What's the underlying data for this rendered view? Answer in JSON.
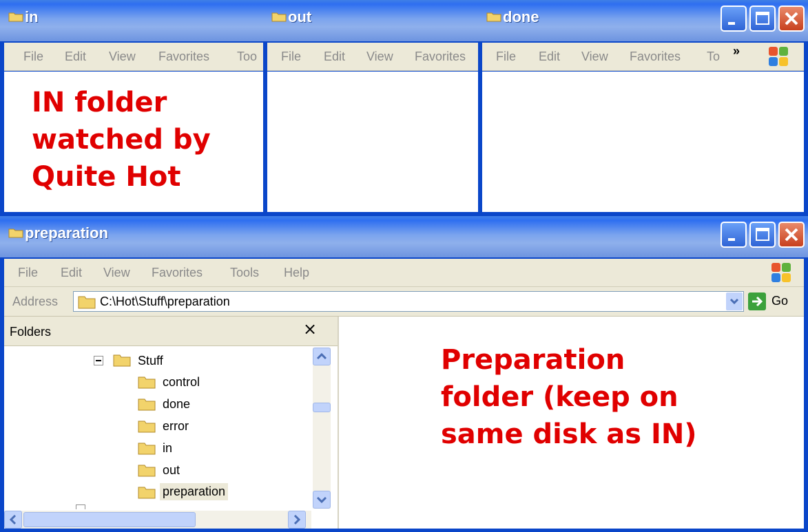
{
  "windows": {
    "in": {
      "title": "in",
      "menu": [
        "File",
        "Edit",
        "View",
        "Favorites",
        "Too"
      ],
      "annotation": [
        "IN folder",
        "watched by",
        "Quite Hot"
      ]
    },
    "out": {
      "title": "out",
      "menu": [
        "File",
        "Edit",
        "View",
        "Favorites"
      ]
    },
    "done": {
      "title": "done",
      "menu": [
        "File",
        "Edit",
        "View",
        "Favorites",
        "To"
      ],
      "chevron": "»"
    },
    "preparation": {
      "title": "preparation",
      "menu": [
        "File",
        "Edit",
        "View",
        "Favorites",
        "Tools",
        "Help"
      ],
      "address_label": "Address",
      "address_value": "C:\\Hot\\Stuff\\preparation",
      "go_label": "Go",
      "folders_label": "Folders",
      "close_glyph": "×",
      "tree": {
        "parent": "Stuff",
        "children": [
          "control",
          "done",
          "error",
          "in",
          "out",
          "preparation"
        ],
        "selected": "preparation"
      },
      "annotation": [
        "Preparation",
        "folder (keep on",
        "same disk as IN)"
      ]
    }
  },
  "icons": {
    "minimize": "minimize-icon",
    "maximize": "maximize-icon",
    "close": "close-icon",
    "folder": "folder-icon",
    "windows_logo": "windows-logo-icon"
  },
  "colors": {
    "title_bar": "#7aa3ee",
    "frame": "#0a46c9",
    "menu_bg": "#ece9d8",
    "annotation": "#e00000",
    "close_button": "#c8401e",
    "folder": "#f2d36b"
  }
}
